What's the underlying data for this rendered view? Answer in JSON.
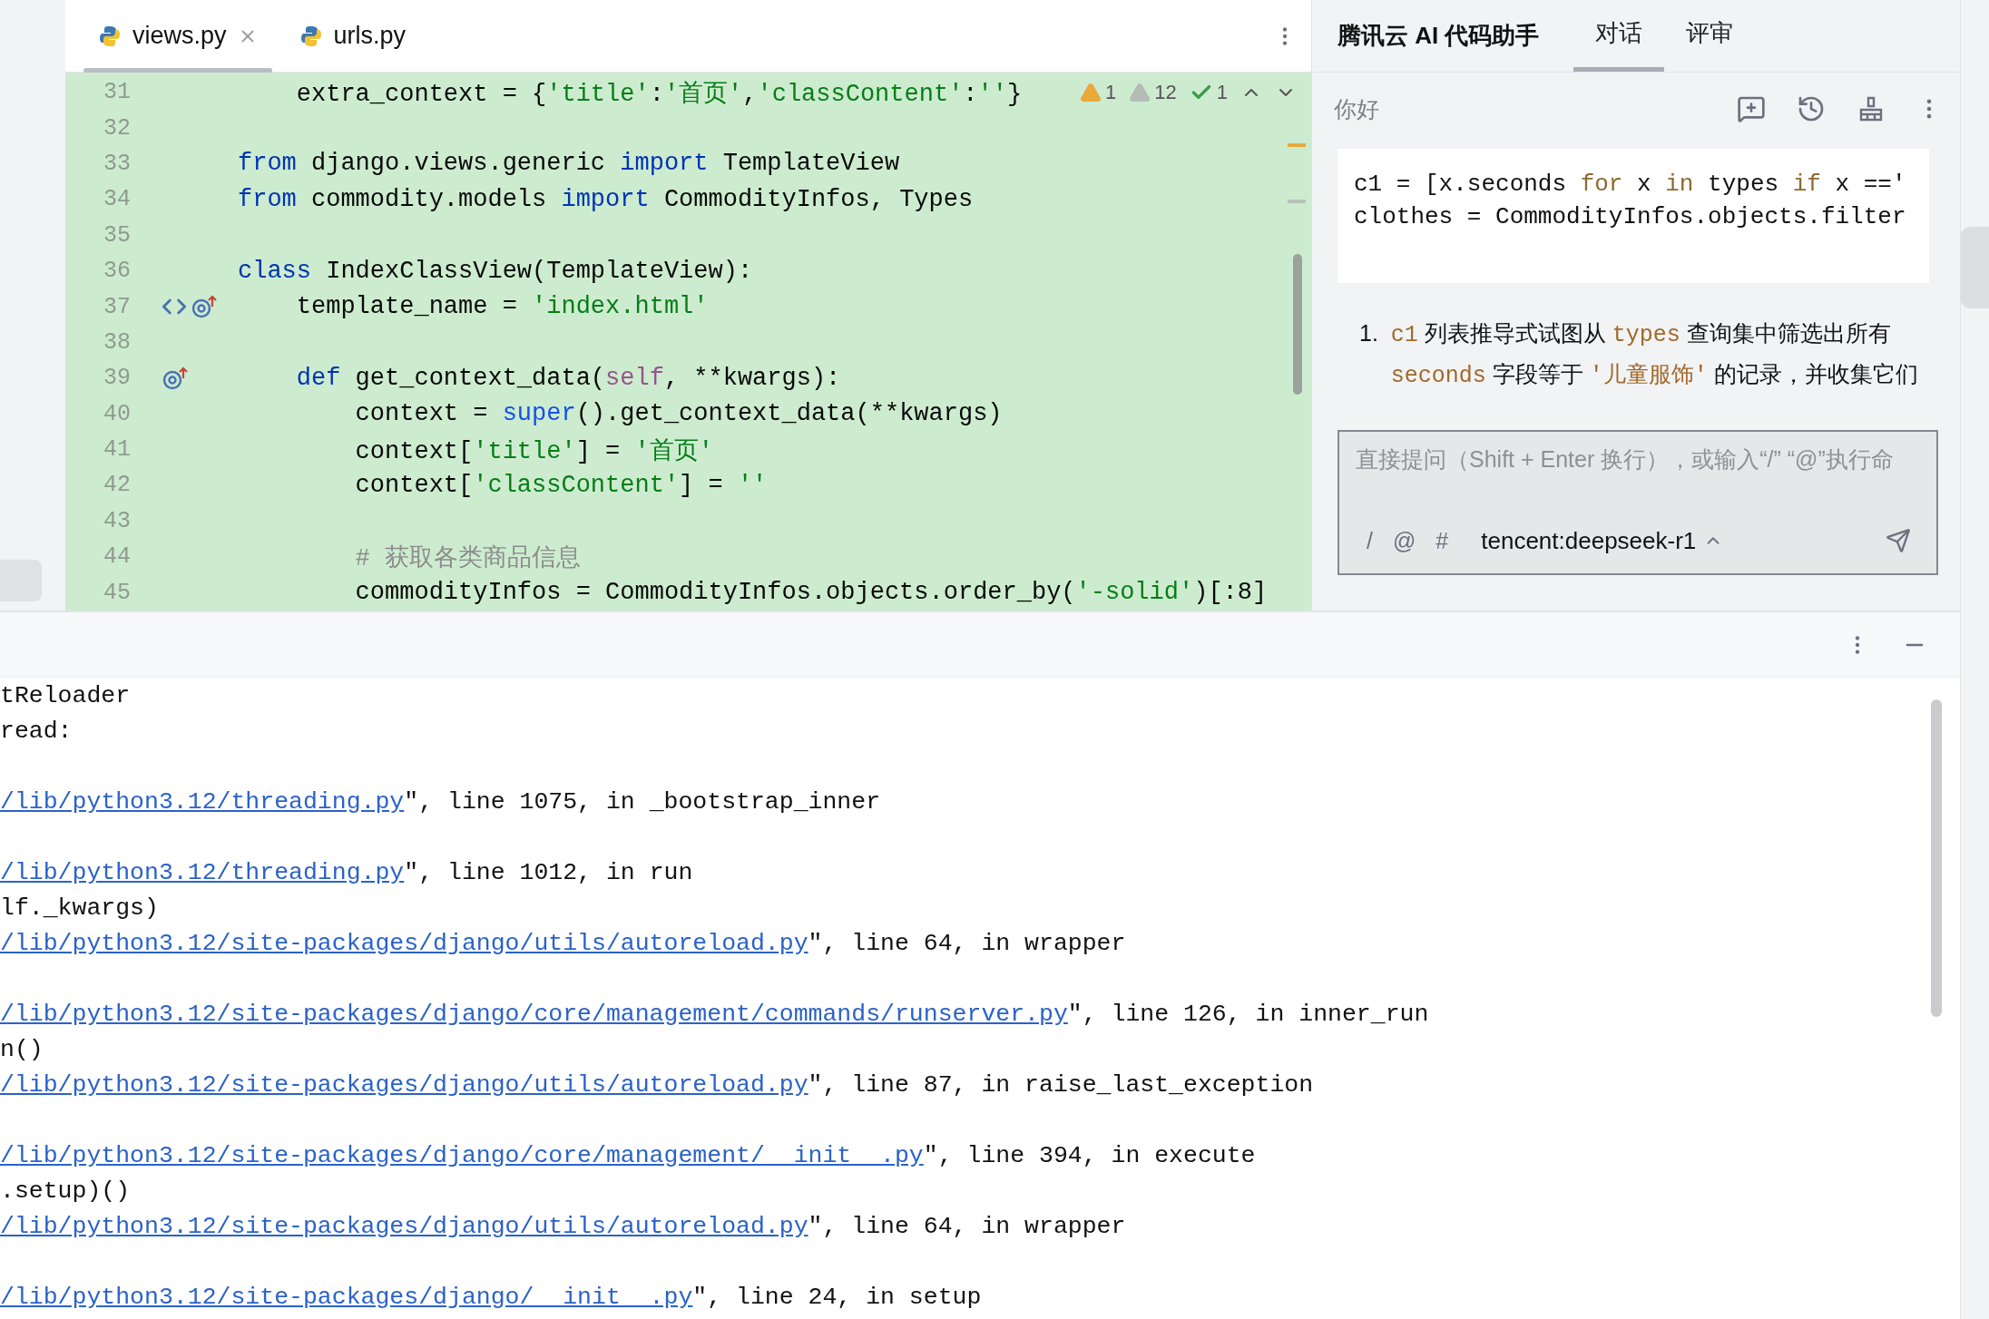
{
  "editor": {
    "tabs": [
      {
        "label": "views.py",
        "selected": true,
        "closable": true
      },
      {
        "label": "urls.py",
        "selected": false,
        "closable": false
      }
    ],
    "inspections": [
      {
        "kind": "warning",
        "count": "1"
      },
      {
        "kind": "weak_warning",
        "count": "12"
      },
      {
        "kind": "typo",
        "count": "1"
      }
    ],
    "lines": [
      {
        "number": "31",
        "tokens": [
          {
            "kind": "plain",
            "text": "    extra_context = {"
          },
          {
            "kind": "str",
            "text": "'title'"
          },
          {
            "kind": "plain",
            "text": ":"
          },
          {
            "kind": "str",
            "text": "'首页'"
          },
          {
            "kind": "plain",
            "text": ","
          },
          {
            "kind": "str",
            "text": "'classContent'"
          },
          {
            "kind": "plain",
            "text": ":"
          },
          {
            "kind": "str",
            "text": "''"
          },
          {
            "kind": "plain",
            "text": "}"
          }
        ]
      },
      {
        "number": "32"
      },
      {
        "number": "33",
        "tokens": [
          {
            "kind": "kw",
            "text": "from"
          },
          {
            "kind": "plain",
            "text": " django.views.generic "
          },
          {
            "kind": "kw",
            "text": "import"
          },
          {
            "kind": "plain",
            "text": " TemplateView"
          }
        ]
      },
      {
        "number": "34",
        "tokens": [
          {
            "kind": "kw",
            "text": "from"
          },
          {
            "kind": "plain",
            "text": " commodity.models "
          },
          {
            "kind": "kw",
            "text": "import"
          },
          {
            "kind": "plain",
            "text": " CommodityInfos, Types"
          }
        ]
      },
      {
        "number": "35"
      },
      {
        "number": "36",
        "tokens": [
          {
            "kind": "kw",
            "text": "class"
          },
          {
            "kind": "plain",
            "text": " IndexClassView(TemplateView):"
          }
        ]
      },
      {
        "number": "37",
        "gutter_icons": [
          {
            "kind": "code"
          },
          {
            "kind": "override"
          }
        ],
        "tokens": [
          {
            "kind": "plain",
            "text": "    template_name = "
          },
          {
            "kind": "str",
            "text": "'index.html'"
          }
        ]
      },
      {
        "number": "38"
      },
      {
        "number": "39",
        "gutter_icons": [
          {
            "kind": "override"
          }
        ],
        "tokens": [
          {
            "kind": "kw",
            "text": "    def"
          },
          {
            "kind": "plain",
            "text": " get_context_data("
          },
          {
            "kind": "self",
            "text": "self"
          },
          {
            "kind": "plain",
            "text": ", **kwargs):"
          }
        ]
      },
      {
        "number": "40",
        "tokens": [
          {
            "kind": "plain",
            "text": "        context = "
          },
          {
            "kind": "builtin",
            "text": "super"
          },
          {
            "kind": "plain",
            "text": "().get_context_data(**kwargs)"
          }
        ]
      },
      {
        "number": "41",
        "tokens": [
          {
            "kind": "plain",
            "text": "        context["
          },
          {
            "kind": "str",
            "text": "'title'"
          },
          {
            "kind": "plain",
            "text": "] = "
          },
          {
            "kind": "str",
            "text": "'首页'"
          }
        ]
      },
      {
        "number": "42",
        "tokens": [
          {
            "kind": "plain",
            "text": "        context["
          },
          {
            "kind": "str",
            "text": "'classContent'"
          },
          {
            "kind": "plain",
            "text": "] = "
          },
          {
            "kind": "str",
            "text": "''"
          }
        ]
      },
      {
        "number": "43"
      },
      {
        "number": "44",
        "tokens": [
          {
            "kind": "comment",
            "text": "        # 获取各类商品信息"
          }
        ]
      },
      {
        "number": "45",
        "tokens": [
          {
            "kind": "plain",
            "text": "        commodityInfos = CommodityInfos.objects.order_by("
          },
          {
            "kind": "str",
            "text": "'-solid'"
          },
          {
            "kind": "plain",
            "text": ")[:8]"
          }
        ]
      }
    ]
  },
  "assistant": {
    "title": "腾讯云 AI 代码助手",
    "tabs": [
      {
        "label": "对话",
        "selected": true
      },
      {
        "label": "评审",
        "selected": false
      }
    ],
    "greeting": "你好",
    "code_lines": [
      [
        {
          "kind": "plain",
          "text": "c1 = [x.seconds "
        },
        {
          "kind": "kw",
          "text": "for"
        },
        {
          "kind": "plain",
          "text": " x "
        },
        {
          "kind": "kw",
          "text": "in"
        },
        {
          "kind": "plain",
          "text": " types "
        },
        {
          "kind": "kw",
          "text": "if"
        },
        {
          "kind": "plain",
          "text": " x =='"
        }
      ],
      [
        {
          "kind": "plain",
          "text": "clothes = CommodityInfos.objects.filter"
        }
      ]
    ],
    "answer": [
      {
        "marker": "1.",
        "segments": [
          {
            "kind": "code",
            "text": "c1"
          },
          {
            "kind": "text",
            "text": " 列表推导式试图从 "
          },
          {
            "kind": "code",
            "text": "types"
          },
          {
            "kind": "text",
            "text": " 查询集中筛选出所有 "
          },
          {
            "kind": "code",
            "text": "seconds"
          },
          {
            "kind": "text",
            "text": " 字段等于 "
          },
          {
            "kind": "code",
            "text": "'儿童服饰'"
          },
          {
            "kind": "text",
            "text": " 的记录，并收集它们"
          }
        ]
      }
    ],
    "input": {
      "placeholder": "直接提问（Shift + Enter 换行），或输入“/” “@”执行命",
      "commands": [
        "/",
        "@",
        "#"
      ],
      "model": "tencent:deepseek-r1"
    }
  },
  "console": {
    "lines": [
      {
        "kind": "text",
        "text": "tReloader"
      },
      {
        "kind": "text",
        "text": "read:"
      },
      {
        "kind": "blank"
      },
      {
        "kind": "link",
        "link": "/lib/python3.12/threading.py",
        "text": "\", line 1075, in _bootstrap_inner"
      },
      {
        "kind": "blank"
      },
      {
        "kind": "link",
        "link": "/lib/python3.12/threading.py",
        "text": "\", line 1012, in run"
      },
      {
        "kind": "text",
        "text": "lf._kwargs)"
      },
      {
        "kind": "link",
        "link": "/lib/python3.12/site-packages/django/utils/autoreload.py",
        "text": "\", line 64, in wrapper"
      },
      {
        "kind": "blank"
      },
      {
        "kind": "link",
        "link": "/lib/python3.12/site-packages/django/core/management/commands/runserver.py",
        "text": "\", line 126, in inner_run"
      },
      {
        "kind": "text",
        "text": "n()"
      },
      {
        "kind": "link",
        "link": "/lib/python3.12/site-packages/django/utils/autoreload.py",
        "text": "\", line 87, in raise_last_exception"
      },
      {
        "kind": "blank"
      },
      {
        "kind": "link",
        "link": "/lib/python3.12/site-packages/django/core/management/__init__.py",
        "text": "\", line 394, in execute"
      },
      {
        "kind": "text",
        "text": ".setup)()"
      },
      {
        "kind": "link",
        "link": "/lib/python3.12/site-packages/django/utils/autoreload.py",
        "text": "\", line 64, in wrapper"
      },
      {
        "kind": "blank"
      },
      {
        "kind": "link",
        "link": "/lib/python3.12/site-packages/django/__init__.py",
        "text": "\", line 24, in setup"
      }
    ]
  }
}
